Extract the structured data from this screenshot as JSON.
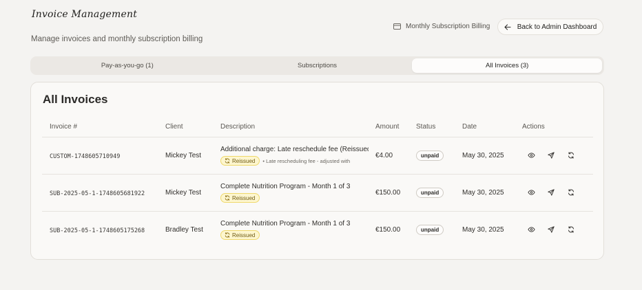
{
  "header": {
    "title": "Invoice Management",
    "subtitle": "Manage invoices and monthly subscription billing",
    "billing_link": "Monthly Subscription Billing",
    "back_button": "Back to Admin Dashboard"
  },
  "tabs": [
    {
      "label": "Pay-as-you-go (1)",
      "active": false
    },
    {
      "label": "Subscriptions",
      "active": false
    },
    {
      "label": "All Invoices (3)",
      "active": true
    }
  ],
  "card": {
    "title": "All Invoices",
    "columns": [
      "Invoice #",
      "Client",
      "Description",
      "Amount",
      "Status",
      "Date",
      "Actions"
    ],
    "rows": [
      {
        "invoice": "CUSTOM-1748605710949",
        "client": "Mickey Test",
        "description": "Additional charge: Late reschedule fee (Reissued)",
        "badge": "Reissued",
        "note": "• Late rescheduling fee - adjusted with",
        "amount": "€4.00",
        "status": "unpaid",
        "date": "May 30, 2025"
      },
      {
        "invoice": "SUB-2025-05-1-1748605681922",
        "client": "Mickey Test",
        "description": "Complete Nutrition Program - Month 1 of 3",
        "badge": "Reissued",
        "note": "",
        "amount": "€150.00",
        "status": "unpaid",
        "date": "May 30, 2025"
      },
      {
        "invoice": "SUB-2025-05-1-1748605175268",
        "client": "Bradley Test",
        "description": "Complete Nutrition Program - Month 1 of 3",
        "badge": "Reissued",
        "note": "",
        "amount": "€150.00",
        "status": "unpaid",
        "date": "May 30, 2025"
      }
    ]
  },
  "icons": {
    "billing": "card-icon",
    "back": "arrow-left-icon",
    "view": "eye-icon",
    "send": "send-icon",
    "reissue": "refresh-icon"
  },
  "colors": {
    "background": "#f4f3f1",
    "badge_bg": "#fdf6cf",
    "badge_border": "#efd86a"
  }
}
